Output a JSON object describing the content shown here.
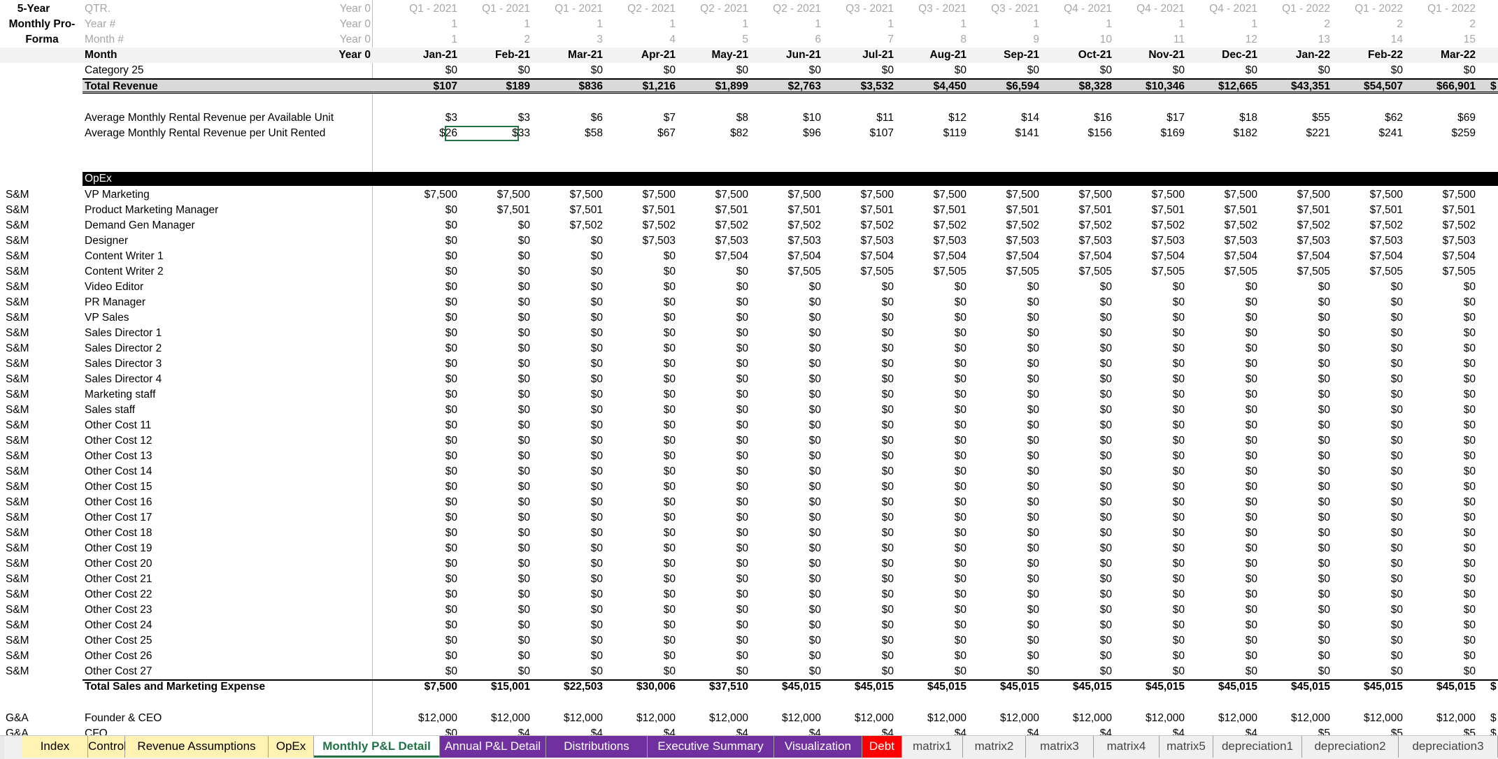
{
  "corner": [
    "5-Year",
    "Monthly Pro-",
    "Forma"
  ],
  "header_rows": [
    {
      "label": "QTR.",
      "y0": "Year 0",
      "values": [
        "Q1 - 2021",
        "Q1 - 2021",
        "Q1 - 2021",
        "Q2 - 2021",
        "Q2 - 2021",
        "Q2 - 2021",
        "Q3 - 2021",
        "Q3 - 2021",
        "Q3 - 2021",
        "Q4 - 2021",
        "Q4 - 2021",
        "Q4 - 2021",
        "Q1 - 2022",
        "Q1 - 2022",
        "Q1 - 2022"
      ]
    },
    {
      "label": "Year #",
      "y0": "Year 0",
      "values": [
        "1",
        "1",
        "1",
        "1",
        "1",
        "1",
        "1",
        "1",
        "1",
        "1",
        "1",
        "1",
        "2",
        "2",
        "2"
      ]
    },
    {
      "label": "Month #",
      "y0": "Year 0",
      "values": [
        "1",
        "2",
        "3",
        "4",
        "5",
        "6",
        "7",
        "8",
        "9",
        "10",
        "11",
        "12",
        "13",
        "14",
        "15"
      ]
    }
  ],
  "month_row": {
    "label": "Month",
    "y0": "Year 0",
    "values": [
      "Jan-21",
      "Feb-21",
      "Mar-21",
      "Apr-21",
      "May-21",
      "Jun-21",
      "Jul-21",
      "Aug-21",
      "Sep-21",
      "Oct-21",
      "Nov-21",
      "Dec-21",
      "Jan-22",
      "Feb-22",
      "Mar-22"
    ]
  },
  "category_row": {
    "label": "Category 25",
    "values": [
      "$0",
      "$0",
      "$0",
      "$0",
      "$0",
      "$0",
      "$0",
      "$0",
      "$0",
      "$0",
      "$0",
      "$0",
      "$0",
      "$0",
      "$0"
    ]
  },
  "total_revenue": {
    "label": "Total Revenue",
    "values": [
      "$107",
      "$189",
      "$836",
      "$1,216",
      "$1,899",
      "$2,763",
      "$3,532",
      "$4,450",
      "$6,594",
      "$8,328",
      "$10,346",
      "$12,665",
      "$43,351",
      "$54,507",
      "$66,901"
    ],
    "cut": "$"
  },
  "avg_rows": [
    {
      "label": "Average Monthly Rental Revenue per Available Unit",
      "values": [
        "$3",
        "$3",
        "$6",
        "$7",
        "$8",
        "$10",
        "$11",
        "$12",
        "$14",
        "$16",
        "$17",
        "$18",
        "$55",
        "$62",
        "$69"
      ]
    },
    {
      "label": "Average Monthly Rental Revenue per Unit Rented",
      "values": [
        "$26",
        "$33",
        "$58",
        "$67",
        "$82",
        "$96",
        "$107",
        "$119",
        "$141",
        "$156",
        "$169",
        "$182",
        "$221",
        "$241",
        "$259"
      ]
    }
  ],
  "opex_header": "OpEx",
  "opex_rows": [
    {
      "cat": "S&M",
      "label": "VP Marketing",
      "values": [
        "$7,500",
        "$7,500",
        "$7,500",
        "$7,500",
        "$7,500",
        "$7,500",
        "$7,500",
        "$7,500",
        "$7,500",
        "$7,500",
        "$7,500",
        "$7,500",
        "$7,500",
        "$7,500",
        "$7,500"
      ]
    },
    {
      "cat": "S&M",
      "label": "Product Marketing Manager",
      "values": [
        "$0",
        "$7,501",
        "$7,501",
        "$7,501",
        "$7,501",
        "$7,501",
        "$7,501",
        "$7,501",
        "$7,501",
        "$7,501",
        "$7,501",
        "$7,501",
        "$7,501",
        "$7,501",
        "$7,501"
      ]
    },
    {
      "cat": "S&M",
      "label": "Demand Gen Manager",
      "values": [
        "$0",
        "$0",
        "$7,502",
        "$7,502",
        "$7,502",
        "$7,502",
        "$7,502",
        "$7,502",
        "$7,502",
        "$7,502",
        "$7,502",
        "$7,502",
        "$7,502",
        "$7,502",
        "$7,502"
      ]
    },
    {
      "cat": "S&M",
      "label": "Designer",
      "values": [
        "$0",
        "$0",
        "$0",
        "$7,503",
        "$7,503",
        "$7,503",
        "$7,503",
        "$7,503",
        "$7,503",
        "$7,503",
        "$7,503",
        "$7,503",
        "$7,503",
        "$7,503",
        "$7,503"
      ]
    },
    {
      "cat": "S&M",
      "label": "Content Writer 1",
      "values": [
        "$0",
        "$0",
        "$0",
        "$0",
        "$7,504",
        "$7,504",
        "$7,504",
        "$7,504",
        "$7,504",
        "$7,504",
        "$7,504",
        "$7,504",
        "$7,504",
        "$7,504",
        "$7,504"
      ]
    },
    {
      "cat": "S&M",
      "label": "Content Writer 2",
      "values": [
        "$0",
        "$0",
        "$0",
        "$0",
        "$0",
        "$7,505",
        "$7,505",
        "$7,505",
        "$7,505",
        "$7,505",
        "$7,505",
        "$7,505",
        "$7,505",
        "$7,505",
        "$7,505"
      ]
    },
    {
      "cat": "S&M",
      "label": "Video Editor",
      "values": [
        "$0",
        "$0",
        "$0",
        "$0",
        "$0",
        "$0",
        "$0",
        "$0",
        "$0",
        "$0",
        "$0",
        "$0",
        "$0",
        "$0",
        "$0"
      ]
    },
    {
      "cat": "S&M",
      "label": "PR Manager",
      "values": [
        "$0",
        "$0",
        "$0",
        "$0",
        "$0",
        "$0",
        "$0",
        "$0",
        "$0",
        "$0",
        "$0",
        "$0",
        "$0",
        "$0",
        "$0"
      ]
    },
    {
      "cat": "S&M",
      "label": "VP Sales",
      "values": [
        "$0",
        "$0",
        "$0",
        "$0",
        "$0",
        "$0",
        "$0",
        "$0",
        "$0",
        "$0",
        "$0",
        "$0",
        "$0",
        "$0",
        "$0"
      ]
    },
    {
      "cat": "S&M",
      "label": "Sales Director 1",
      "values": [
        "$0",
        "$0",
        "$0",
        "$0",
        "$0",
        "$0",
        "$0",
        "$0",
        "$0",
        "$0",
        "$0",
        "$0",
        "$0",
        "$0",
        "$0"
      ]
    },
    {
      "cat": "S&M",
      "label": "Sales Director 2",
      "values": [
        "$0",
        "$0",
        "$0",
        "$0",
        "$0",
        "$0",
        "$0",
        "$0",
        "$0",
        "$0",
        "$0",
        "$0",
        "$0",
        "$0",
        "$0"
      ]
    },
    {
      "cat": "S&M",
      "label": "Sales Director 3",
      "values": [
        "$0",
        "$0",
        "$0",
        "$0",
        "$0",
        "$0",
        "$0",
        "$0",
        "$0",
        "$0",
        "$0",
        "$0",
        "$0",
        "$0",
        "$0"
      ]
    },
    {
      "cat": "S&M",
      "label": "Sales Director 4",
      "values": [
        "$0",
        "$0",
        "$0",
        "$0",
        "$0",
        "$0",
        "$0",
        "$0",
        "$0",
        "$0",
        "$0",
        "$0",
        "$0",
        "$0",
        "$0"
      ]
    },
    {
      "cat": "S&M",
      "label": "Marketing staff",
      "values": [
        "$0",
        "$0",
        "$0",
        "$0",
        "$0",
        "$0",
        "$0",
        "$0",
        "$0",
        "$0",
        "$0",
        "$0",
        "$0",
        "$0",
        "$0"
      ]
    },
    {
      "cat": "S&M",
      "label": "Sales staff",
      "values": [
        "$0",
        "$0",
        "$0",
        "$0",
        "$0",
        "$0",
        "$0",
        "$0",
        "$0",
        "$0",
        "$0",
        "$0",
        "$0",
        "$0",
        "$0"
      ]
    },
    {
      "cat": "S&M",
      "label": "Other Cost 11",
      "values": [
        "$0",
        "$0",
        "$0",
        "$0",
        "$0",
        "$0",
        "$0",
        "$0",
        "$0",
        "$0",
        "$0",
        "$0",
        "$0",
        "$0",
        "$0"
      ]
    },
    {
      "cat": "S&M",
      "label": "Other Cost 12",
      "values": [
        "$0",
        "$0",
        "$0",
        "$0",
        "$0",
        "$0",
        "$0",
        "$0",
        "$0",
        "$0",
        "$0",
        "$0",
        "$0",
        "$0",
        "$0"
      ]
    },
    {
      "cat": "S&M",
      "label": "Other Cost 13",
      "values": [
        "$0",
        "$0",
        "$0",
        "$0",
        "$0",
        "$0",
        "$0",
        "$0",
        "$0",
        "$0",
        "$0",
        "$0",
        "$0",
        "$0",
        "$0"
      ]
    },
    {
      "cat": "S&M",
      "label": "Other Cost 14",
      "values": [
        "$0",
        "$0",
        "$0",
        "$0",
        "$0",
        "$0",
        "$0",
        "$0",
        "$0",
        "$0",
        "$0",
        "$0",
        "$0",
        "$0",
        "$0"
      ]
    },
    {
      "cat": "S&M",
      "label": "Other Cost 15",
      "values": [
        "$0",
        "$0",
        "$0",
        "$0",
        "$0",
        "$0",
        "$0",
        "$0",
        "$0",
        "$0",
        "$0",
        "$0",
        "$0",
        "$0",
        "$0"
      ]
    },
    {
      "cat": "S&M",
      "label": "Other Cost 16",
      "values": [
        "$0",
        "$0",
        "$0",
        "$0",
        "$0",
        "$0",
        "$0",
        "$0",
        "$0",
        "$0",
        "$0",
        "$0",
        "$0",
        "$0",
        "$0"
      ]
    },
    {
      "cat": "S&M",
      "label": "Other Cost 17",
      "values": [
        "$0",
        "$0",
        "$0",
        "$0",
        "$0",
        "$0",
        "$0",
        "$0",
        "$0",
        "$0",
        "$0",
        "$0",
        "$0",
        "$0",
        "$0"
      ]
    },
    {
      "cat": "S&M",
      "label": "Other Cost 18",
      "values": [
        "$0",
        "$0",
        "$0",
        "$0",
        "$0",
        "$0",
        "$0",
        "$0",
        "$0",
        "$0",
        "$0",
        "$0",
        "$0",
        "$0",
        "$0"
      ]
    },
    {
      "cat": "S&M",
      "label": "Other Cost 19",
      "values": [
        "$0",
        "$0",
        "$0",
        "$0",
        "$0",
        "$0",
        "$0",
        "$0",
        "$0",
        "$0",
        "$0",
        "$0",
        "$0",
        "$0",
        "$0"
      ]
    },
    {
      "cat": "S&M",
      "label": "Other Cost 20",
      "values": [
        "$0",
        "$0",
        "$0",
        "$0",
        "$0",
        "$0",
        "$0",
        "$0",
        "$0",
        "$0",
        "$0",
        "$0",
        "$0",
        "$0",
        "$0"
      ]
    },
    {
      "cat": "S&M",
      "label": "Other Cost 21",
      "values": [
        "$0",
        "$0",
        "$0",
        "$0",
        "$0",
        "$0",
        "$0",
        "$0",
        "$0",
        "$0",
        "$0",
        "$0",
        "$0",
        "$0",
        "$0"
      ]
    },
    {
      "cat": "S&M",
      "label": "Other Cost 22",
      "values": [
        "$0",
        "$0",
        "$0",
        "$0",
        "$0",
        "$0",
        "$0",
        "$0",
        "$0",
        "$0",
        "$0",
        "$0",
        "$0",
        "$0",
        "$0"
      ]
    },
    {
      "cat": "S&M",
      "label": "Other Cost 23",
      "values": [
        "$0",
        "$0",
        "$0",
        "$0",
        "$0",
        "$0",
        "$0",
        "$0",
        "$0",
        "$0",
        "$0",
        "$0",
        "$0",
        "$0",
        "$0"
      ]
    },
    {
      "cat": "S&M",
      "label": "Other Cost 24",
      "values": [
        "$0",
        "$0",
        "$0",
        "$0",
        "$0",
        "$0",
        "$0",
        "$0",
        "$0",
        "$0",
        "$0",
        "$0",
        "$0",
        "$0",
        "$0"
      ]
    },
    {
      "cat": "S&M",
      "label": "Other Cost 25",
      "values": [
        "$0",
        "$0",
        "$0",
        "$0",
        "$0",
        "$0",
        "$0",
        "$0",
        "$0",
        "$0",
        "$0",
        "$0",
        "$0",
        "$0",
        "$0"
      ]
    },
    {
      "cat": "S&M",
      "label": "Other Cost 26",
      "values": [
        "$0",
        "$0",
        "$0",
        "$0",
        "$0",
        "$0",
        "$0",
        "$0",
        "$0",
        "$0",
        "$0",
        "$0",
        "$0",
        "$0",
        "$0"
      ]
    },
    {
      "cat": "S&M",
      "label": "Other Cost 27",
      "values": [
        "$0",
        "$0",
        "$0",
        "$0",
        "$0",
        "$0",
        "$0",
        "$0",
        "$0",
        "$0",
        "$0",
        "$0",
        "$0",
        "$0",
        "$0"
      ]
    }
  ],
  "total_sm": {
    "label": "Total Sales and Marketing Expense",
    "values": [
      "$7,500",
      "$15,001",
      "$22,503",
      "$30,006",
      "$37,510",
      "$45,015",
      "$45,015",
      "$45,015",
      "$45,015",
      "$45,015",
      "$45,015",
      "$45,015",
      "$45,015",
      "$45,015",
      "$45,015"
    ],
    "cut": "$"
  },
  "ga_rows": [
    {
      "cat": "G&A",
      "label": "Founder & CEO",
      "values": [
        "$12,000",
        "$12,000",
        "$12,000",
        "$12,000",
        "$12,000",
        "$12,000",
        "$12,000",
        "$12,000",
        "$12,000",
        "$12,000",
        "$12,000",
        "$12,000",
        "$12,000",
        "$12,000",
        "$12,000"
      ],
      "cut": "$"
    },
    {
      "cat": "G&A",
      "label": "CFO",
      "values": [
        "$0",
        "$4",
        "$4",
        "$4",
        "$4",
        "$4",
        "$4",
        "$4",
        "$4",
        "$4",
        "$4",
        "$4",
        "$5",
        "$5",
        "$5"
      ],
      "cut": "$"
    }
  ],
  "tabs": [
    {
      "label": "Index",
      "bg": "#fff2b3",
      "fg": "#000000"
    },
    {
      "label": "Control",
      "bg": "#fff2b3",
      "fg": "#000000"
    },
    {
      "label": "Revenue Assumptions",
      "bg": "#fff2b3",
      "fg": "#000000"
    },
    {
      "label": "OpEx",
      "bg": "#fff2b3",
      "fg": "#000000"
    },
    {
      "label": "Monthly P&L Detail",
      "bg": "#ffffff",
      "fg": "#217346",
      "active": true
    },
    {
      "label": "Annual P&L Detail",
      "bg": "#7030a0",
      "fg": "#ffffff"
    },
    {
      "label": "Distributions",
      "bg": "#7030a0",
      "fg": "#ffffff"
    },
    {
      "label": "Executive Summary",
      "bg": "#7030a0",
      "fg": "#ffffff"
    },
    {
      "label": "Visualization",
      "bg": "#7030a0",
      "fg": "#ffffff"
    },
    {
      "label": "Debt",
      "bg": "#ff0000",
      "fg": "#ffffff"
    },
    {
      "label": "matrix1",
      "bg": "#f0f0f0",
      "fg": "#444444"
    },
    {
      "label": "matrix2",
      "bg": "#f0f0f0",
      "fg": "#444444"
    },
    {
      "label": "matrix3",
      "bg": "#f0f0f0",
      "fg": "#444444"
    },
    {
      "label": "matrix4",
      "bg": "#f0f0f0",
      "fg": "#444444"
    },
    {
      "label": "matrix5",
      "bg": "#f0f0f0",
      "fg": "#444444"
    },
    {
      "label": "depreciation1",
      "bg": "#f0f0f0",
      "fg": "#444444"
    },
    {
      "label": "depreciation2",
      "bg": "#f0f0f0",
      "fg": "#444444"
    },
    {
      "label": "depreciation3",
      "bg": "#f0f0f0",
      "fg": "#444444"
    }
  ]
}
